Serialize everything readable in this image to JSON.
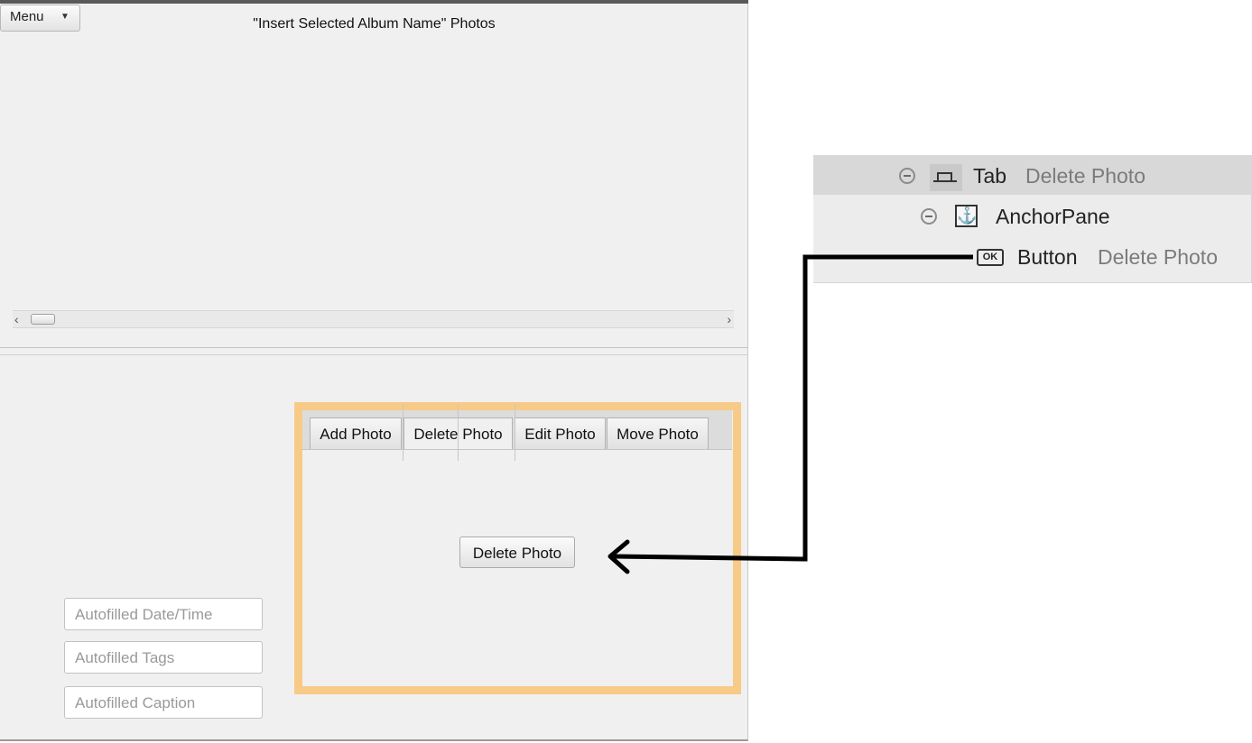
{
  "app": {
    "menu_label": "Menu",
    "album_title": "\"Insert Selected Album Name\" Photos"
  },
  "tabs": [
    {
      "label": "Add Photo",
      "selected": false
    },
    {
      "label": "Delete Photo",
      "selected": true
    },
    {
      "label": "Edit Photo",
      "selected": false
    },
    {
      "label": "Move Photo",
      "selected": false
    }
  ],
  "delete_button_label": "Delete Photo",
  "fields": {
    "datetime_placeholder": "Autofilled Date/Time",
    "tags_placeholder": "Autofilled Tags",
    "caption_placeholder": "Autofilled Caption"
  },
  "hierarchy": {
    "tab": {
      "type": "Tab",
      "text": "Delete Photo"
    },
    "anchor": {
      "type": "AnchorPane"
    },
    "button": {
      "type": "Button",
      "text": "Delete Photo",
      "icon_text": "OK"
    }
  },
  "colors": {
    "highlight": "#f8ca87",
    "window_bg": "#f0f0f0"
  }
}
